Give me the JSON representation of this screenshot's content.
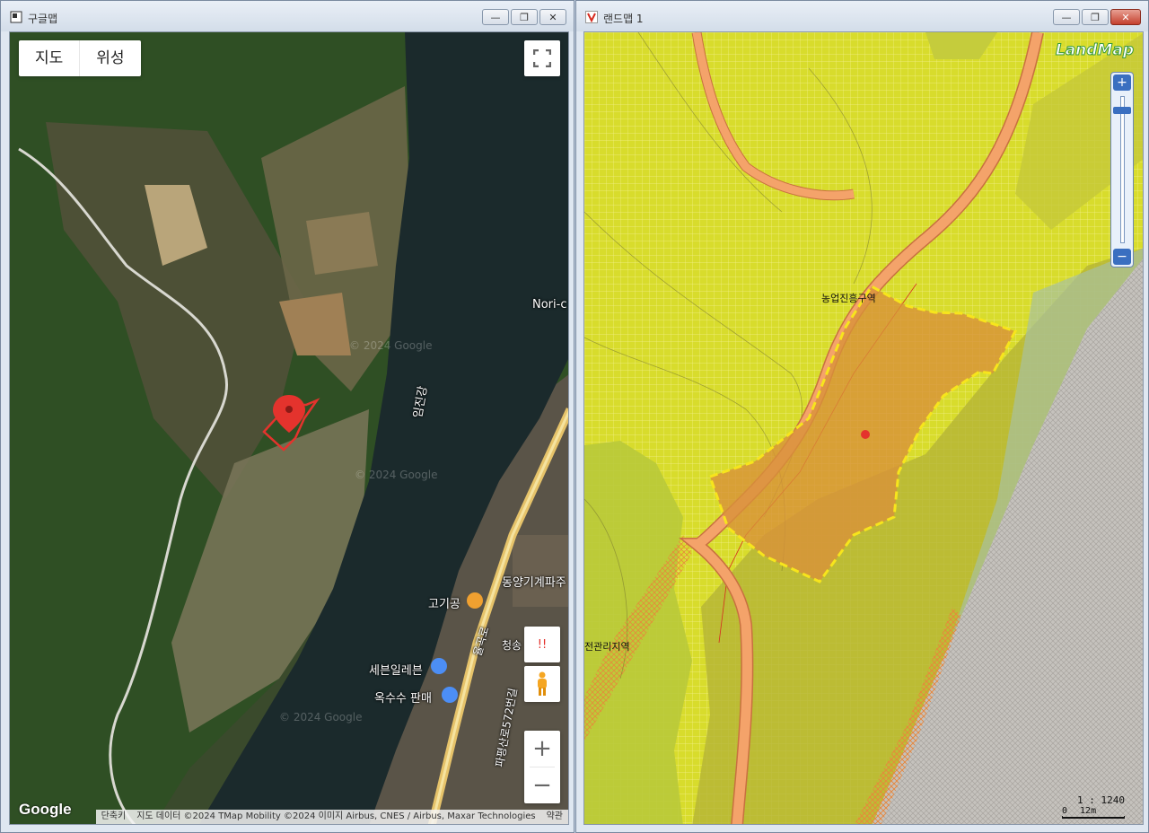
{
  "left_window": {
    "title": "구글맵",
    "map_type": {
      "map_label": "지도",
      "satellite_label": "위성"
    },
    "labels": {
      "river": "임진강",
      "nori": "Nori-c",
      "dongyang": "동양기계파주",
      "gogigong": "고기공",
      "cheongsong": "청송",
      "seven_eleven": "세븐일레븐",
      "oksusu": "옥수수 판매",
      "road_main": "율곡로",
      "road_side": "파평산로572번길"
    },
    "watermarks": [
      "© 2024 Google",
      "© 2024 Google",
      "© 2024 Google"
    ],
    "logo": "Google",
    "attribution": {
      "shortcuts": "단축키",
      "data": "지도 데이터 ©2024 TMap Mobility ©2024 이미지 Airbus, CNES / Airbus, Maxar Technologies",
      "terms": "약관"
    },
    "alert_label": "!!",
    "zoom_in": "+",
    "zoom_out": "−"
  },
  "right_window": {
    "title": "랜드맵 1",
    "logo": "LandMap",
    "labels": {
      "zone_agri": "농업진흥구역",
      "zone_mgmt": "전관리지역"
    },
    "scale": {
      "ratio": "1 : 1240",
      "start": "0",
      "distance": "12m"
    }
  },
  "window_controls": {
    "minimize": "—",
    "restore": "❐",
    "close": "✕"
  },
  "colors": {
    "satellite_forest": "#2f4f24",
    "river": "#1b2a2c",
    "land_yellow": "#d8dc2c",
    "road": "#f4a36a",
    "parcel": "#d8913a",
    "marker": "#e4332d",
    "gray_zone": "#c5c2bd"
  }
}
